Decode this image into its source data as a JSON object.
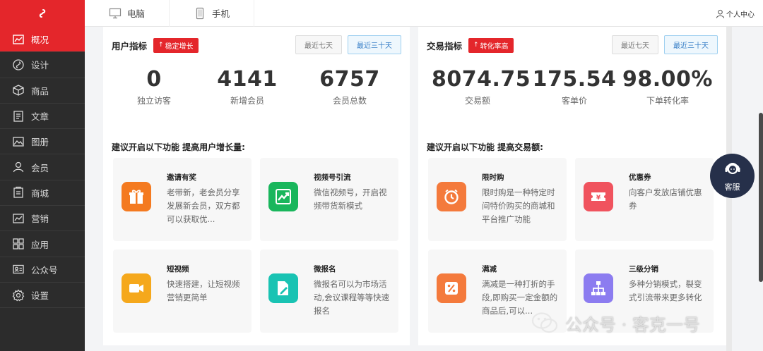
{
  "sidebar": {
    "items": [
      {
        "label": "概况",
        "icon": "chart-icon"
      },
      {
        "label": "设计",
        "icon": "design-icon"
      },
      {
        "label": "商品",
        "icon": "box-icon"
      },
      {
        "label": "文章",
        "icon": "article-icon"
      },
      {
        "label": "图册",
        "icon": "image-icon"
      },
      {
        "label": "会员",
        "icon": "user-icon"
      },
      {
        "label": "商城",
        "icon": "store-icon"
      },
      {
        "label": "营销",
        "icon": "marketing-icon"
      },
      {
        "label": "应用",
        "icon": "apps-icon"
      },
      {
        "label": "公众号",
        "icon": "id-card-icon"
      },
      {
        "label": "设置",
        "icon": "gear-icon"
      }
    ]
  },
  "topbar": {
    "tabs": [
      {
        "label": "电脑",
        "icon": "monitor-icon"
      },
      {
        "label": "手机",
        "icon": "phone-icon"
      }
    ],
    "user_center": "个人中心"
  },
  "user_panel": {
    "title": "用户指标",
    "badge": "稳定增长",
    "btn_week": "最近七天",
    "btn_month": "最近三十天",
    "stats": [
      {
        "value": "0",
        "label": "独立访客"
      },
      {
        "value": "4141",
        "label": "新增会员"
      },
      {
        "value": "6757",
        "label": "会员总数"
      }
    ],
    "suggest": "建议开启以下功能 提高用户增长量:",
    "cards": [
      {
        "title": "邀请有奖",
        "desc": "老带新，老会员分享发展新会员，双方都可以获取优...",
        "icon": "gift-icon",
        "color": "#f47a20"
      },
      {
        "title": "视频号引流",
        "desc": "微信视频号，开启视频带货新模式",
        "icon": "trend-icon",
        "color": "#19b65c"
      },
      {
        "title": "短视频",
        "desc": "快速搭建，让短视频营销更简单",
        "icon": "video-icon",
        "color": "#f5a81c"
      },
      {
        "title": "微报名",
        "desc": "微报名可以为市场活动,会议课程等等快速报名",
        "icon": "signup-icon",
        "color": "#19c3b3"
      }
    ]
  },
  "trade_panel": {
    "title": "交易指标",
    "badge": "转化率高",
    "btn_week": "最近七天",
    "btn_month": "最近三十天",
    "stats": [
      {
        "value": "8074.75",
        "label": "交易额"
      },
      {
        "value": "175.54",
        "label": "客单价"
      },
      {
        "value": "98.00%",
        "label": "下单转化率"
      }
    ],
    "suggest": "建议开启以下功能 提高交易额:",
    "cards": [
      {
        "title": "限时购",
        "desc": "限时购是一种特定时间特价购买的商城和平台推广功能",
        "icon": "timer-icon",
        "color": "#f47a3c"
      },
      {
        "title": "优惠券",
        "desc": "向客户发放店铺优惠券",
        "icon": "coupon-icon",
        "color": "#f0535e"
      },
      {
        "title": "满减",
        "desc": "满减是一种打折的手段,即购买一定金额的商品后,可以...",
        "icon": "percent-icon",
        "color": "#f47a3c"
      },
      {
        "title": "三级分销",
        "desc": "多种分销模式，裂变式引流带来更多转化",
        "icon": "hierarchy-icon",
        "color": "#8c7cf0"
      }
    ]
  },
  "service": {
    "label": "客服"
  },
  "watermark": {
    "text": "公众号 · 客克一号"
  }
}
